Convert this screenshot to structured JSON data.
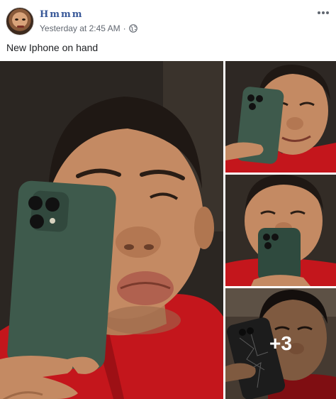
{
  "post": {
    "author": "Hmmm",
    "timestamp": "Yesterday at 2:45 AM",
    "separator": "·",
    "privacy_icon": "globe-icon",
    "more_icon": "more-options-icon",
    "text": "New Iphone on hand"
  },
  "gallery": {
    "more_count": "+3",
    "photos": [
      {
        "label": "selfie-kiss-with-green-iphone"
      },
      {
        "label": "selfie-smile-with-green-iphone"
      },
      {
        "label": "selfie-phone-covering-mouth"
      },
      {
        "label": "selfie-cracked-phone"
      }
    ]
  },
  "colors": {
    "author_link": "#385898",
    "meta_text": "#616770",
    "shirt_red": "#c4161c",
    "phone_green": "#3e5a4c",
    "skin": "#c48a63"
  }
}
